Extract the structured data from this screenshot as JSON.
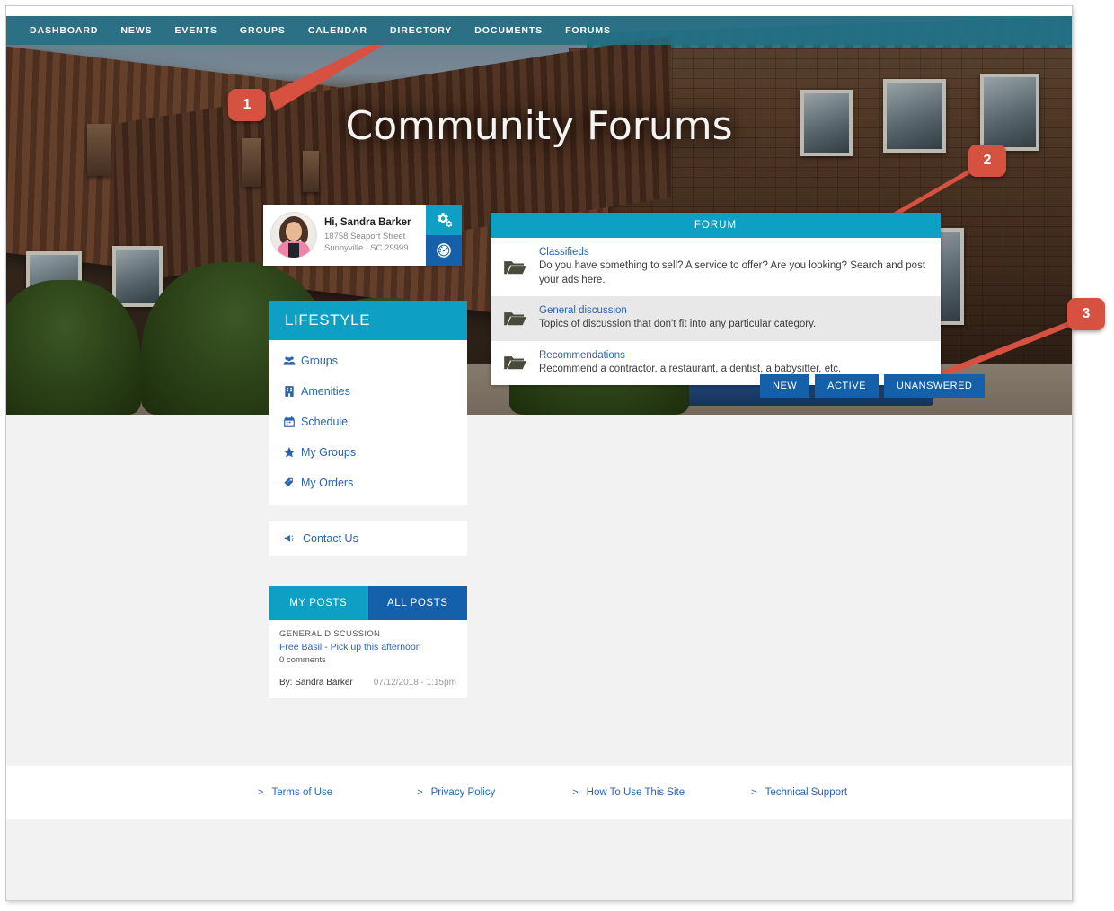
{
  "nav": {
    "items": [
      {
        "label": "DASHBOARD"
      },
      {
        "label": "NEWS"
      },
      {
        "label": "EVENTS"
      },
      {
        "label": "GROUPS"
      },
      {
        "label": "CALENDAR"
      },
      {
        "label": "DIRECTORY"
      },
      {
        "label": "DOCUMENTS"
      },
      {
        "label": "FORUMS"
      }
    ]
  },
  "hero": {
    "title": "Community Forums"
  },
  "profile": {
    "greeting": "Hi, Sandra Barker",
    "address_line1": "18758 Seaport Street",
    "address_line2": "Sunnyville , SC 29999",
    "tiles": [
      {
        "icon": "gears-icon",
        "color": "#0e9fc4"
      },
      {
        "icon": "gauge-icon",
        "color": "#1560ab"
      }
    ],
    "avatar_icon": "avatar"
  },
  "sidebar": {
    "heading": "LIFESTYLE",
    "items": [
      {
        "label": "Groups",
        "icon": "users-group-icon"
      },
      {
        "label": "Amenities",
        "icon": "building-icon"
      },
      {
        "label": "Schedule",
        "icon": "calendar-icon"
      },
      {
        "label": "My Groups",
        "icon": "star-icon"
      },
      {
        "label": "My Orders",
        "icon": "tags-icon"
      }
    ],
    "contact": {
      "label": "Contact Us",
      "icon": "bullhorn-icon"
    }
  },
  "posts_widget": {
    "tabs": [
      {
        "label": "MY POSTS",
        "active": true
      },
      {
        "label": "ALL POSTS",
        "active": false
      }
    ],
    "post": {
      "category": "GENERAL DISCUSSION",
      "title": "Free Basil - Pick up this afternoon",
      "comments": "0 comments",
      "author": "By: Sandra Barker",
      "date": "07/12/2018 - 1:15pm"
    }
  },
  "forum": {
    "header": "FORUM",
    "rows": [
      {
        "name": "Classifieds",
        "description": "Do you have something to sell? A service to offer? Are you looking? Search and post your ads here.",
        "icon": "folder-open-icon"
      },
      {
        "name": "General discussion",
        "description": "Topics of discussion that don't fit into any particular category.",
        "icon": "folder-open-icon"
      },
      {
        "name": "Recommendations",
        "description": "Recommend a contractor, a restaurant, a dentist, a babysitter, etc.",
        "icon": "folder-open-icon"
      }
    ]
  },
  "filters": [
    {
      "label": "NEW"
    },
    {
      "label": "ACTIVE"
    },
    {
      "label": "UNANSWERED"
    }
  ],
  "footer": {
    "links": [
      {
        "label": "Terms of Use"
      },
      {
        "label": "Privacy Policy"
      },
      {
        "label": "How To Use This Site"
      },
      {
        "label": "Technical Support"
      }
    ],
    "bullet": ">"
  },
  "callouts": [
    {
      "number": "1"
    },
    {
      "number": "2"
    },
    {
      "number": "3"
    }
  ],
  "colors": {
    "accent_cyan": "#0e9fc4",
    "accent_blue": "#1560ab",
    "link_blue": "#2a63b0",
    "callout_red": "#d6513f",
    "nav_teal": "#236e85"
  }
}
